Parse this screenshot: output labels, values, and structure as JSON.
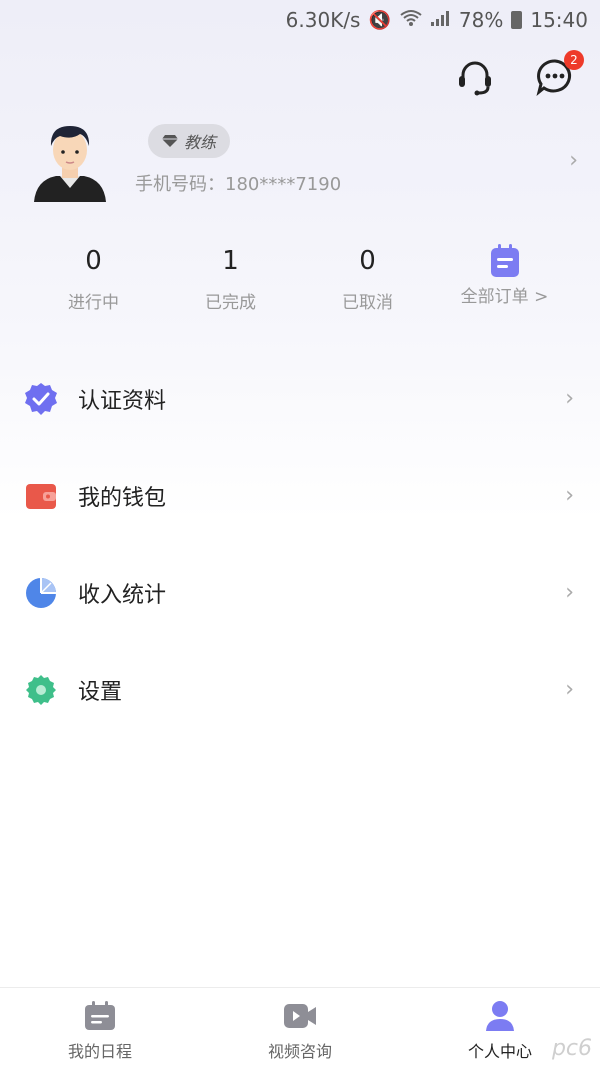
{
  "status_bar": {
    "speed": "6.30K/s",
    "battery": "78%",
    "time": "15:40"
  },
  "header": {
    "message_badge": "2"
  },
  "profile": {
    "role": "教练",
    "phone_label": "手机号码：180****7190"
  },
  "stats": [
    {
      "value": "0",
      "label": "进行中"
    },
    {
      "value": "1",
      "label": "已完成"
    },
    {
      "value": "0",
      "label": "已取消"
    }
  ],
  "orders": {
    "label": "全部订单 >"
  },
  "menu": [
    {
      "label": "认证资料",
      "icon": "verified-badge-icon"
    },
    {
      "label": "我的钱包",
      "icon": "wallet-icon"
    },
    {
      "label": "收入统计",
      "icon": "pie-chart-icon"
    },
    {
      "label": "设置",
      "icon": "gear-icon"
    }
  ],
  "tabs": [
    {
      "label": "我的日程",
      "icon": "calendar-icon"
    },
    {
      "label": "视频咨询",
      "icon": "video-icon"
    },
    {
      "label": "个人中心",
      "icon": "person-icon"
    }
  ],
  "watermark": "pc6",
  "colors": {
    "accent": "#6f6ff0",
    "badge_red": "#ee3a2a",
    "wallet": "#e9584a",
    "chart_blue": "#4f86e8",
    "settings_green": "#3fbf8a"
  }
}
